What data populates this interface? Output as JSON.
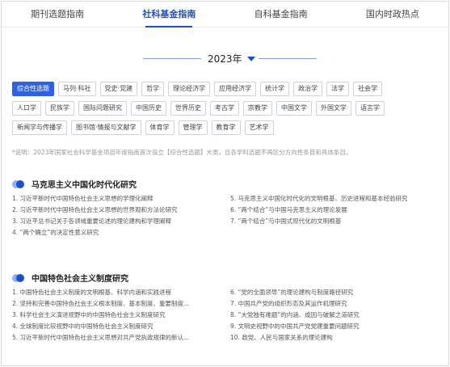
{
  "tabs": [
    "期刊选题指南",
    "社科基金指南",
    "自科基金指南",
    "国内时政热点"
  ],
  "active_tab": 1,
  "year": "2023年",
  "accent_color": "#2d63e2",
  "chips": [
    [
      "综合性选题",
      "马列·科社",
      "党史·党建",
      "哲学",
      "理论经济学",
      "应用经济学",
      "统计学",
      "政治学",
      "法学",
      "社会学"
    ],
    [
      "人口学",
      "民族学",
      "国际问题研究",
      "中国历史",
      "世界历史",
      "考古学",
      "宗教学",
      "中国文学",
      "外国文学",
      "语言学"
    ],
    [
      "新闻学与传播学",
      "图书馆·情报与文献学",
      "体育学",
      "管理学",
      "教育学",
      "艺术学"
    ]
  ],
  "note": "*说明：2023年国家社会科学基金项目年度指南首次设立【综合性选题】大类，且各学科选题不再区分方向性条目和具体条目。",
  "sections": [
    {
      "title": "马克思主义中国化时代化研究",
      "rows": [
        [
          "1. 习近平新时代中国特色社会主义思想的学理化阐释",
          "5. 马克思主义中国化时代化的文明根基、历史进程和基本经验研究"
        ],
        [
          "2. 习近平新时代中国特色社会主义思想的世界观和方法论研究",
          "6. “两个结合”与中国马克思主义的理论发展"
        ],
        [
          "3. 习近平总书记关于各领域重要论述的理论建构和学理阐释",
          "7. “两个结合”与中国式现代化的文明根基"
        ],
        [
          "4. “两个确立”的决定性意义研究",
          ""
        ]
      ]
    },
    {
      "title": "中国特色社会主义制度研究",
      "rows": [
        [
          "1. 中国特色社会主义制度的文明根基、科学内涵和实践进程",
          "6. “党的全面领导”的理论建构与制度路径研究"
        ],
        [
          "2. 坚持和完善中国特色社会主义根本制度、基本制度、重要制度...",
          "7. 中国共产党的组织形态及其运作机理研究"
        ],
        [
          "3. 科学社会主义演进视野中的中国特色社会主义制度研究",
          "8. “大党独有难题”的内涵、成因与破解之道研究"
        ],
        [
          "4. 全球制度比较视野中的中国特色社会主义制度研究",
          "9. 文明史视野中的中国共产党党建重要问题研究"
        ],
        [
          "5. 习近平新时代中国特色社会主义思想对共产党执政规律的新认...",
          "10. 政党、人民与国家关系的理论建构"
        ]
      ]
    }
  ]
}
